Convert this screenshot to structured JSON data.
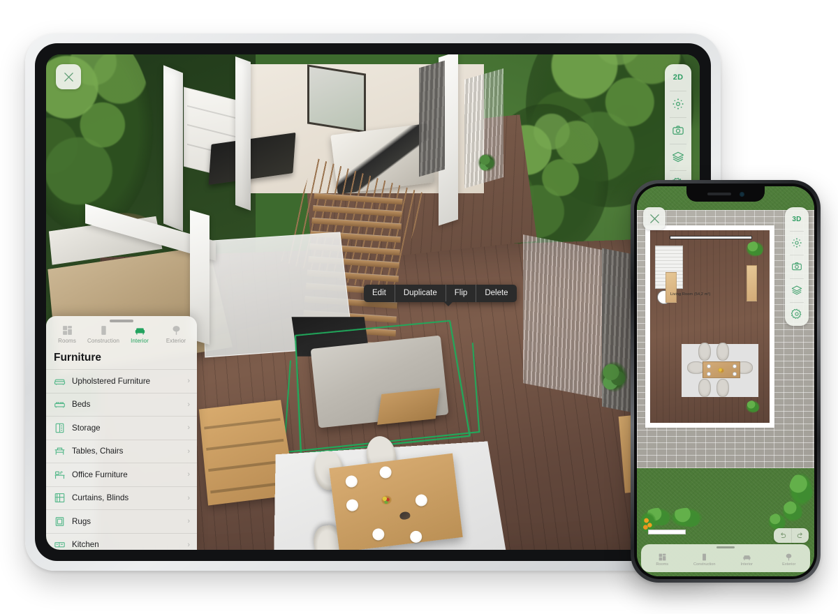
{
  "app": {
    "accent_green": "#23a35f",
    "selection_green": "#1faa5b",
    "panel_bg": "#f3f3f0",
    "context_menu_bg": "#2b2b2b"
  },
  "tablet": {
    "close_button": {
      "icon": "close-icon",
      "label": "Close"
    },
    "toolbar": [
      {
        "name": "view-mode-toggle",
        "icon": "2d-label",
        "label": "2D"
      },
      {
        "name": "orbit-tool",
        "icon": "orbit-icon",
        "label": ""
      },
      {
        "name": "camera-tool",
        "icon": "camera-icon",
        "label": ""
      },
      {
        "name": "layers-tool",
        "icon": "layers-icon",
        "label": ""
      },
      {
        "name": "settings-tool",
        "icon": "gear-icon",
        "label": ""
      }
    ],
    "context_menu": {
      "items": [
        {
          "label": "Edit"
        },
        {
          "label": "Duplicate"
        },
        {
          "label": "Flip"
        },
        {
          "label": "Delete"
        }
      ]
    },
    "panel": {
      "tabs": [
        {
          "label": "Rooms",
          "icon": "rooms-icon",
          "active": false
        },
        {
          "label": "Construction",
          "icon": "construction-icon",
          "active": false
        },
        {
          "label": "Interior",
          "icon": "interior-icon",
          "active": true
        },
        {
          "label": "Exterior",
          "icon": "exterior-icon",
          "active": false
        }
      ],
      "title": "Furniture",
      "items": [
        {
          "label": "Upholstered Furniture",
          "icon": "sofa-icon",
          "chevron": "›"
        },
        {
          "label": "Beds",
          "icon": "bed-icon",
          "chevron": "›"
        },
        {
          "label": "Storage",
          "icon": "storage-icon",
          "chevron": "›"
        },
        {
          "label": "Tables, Chairs",
          "icon": "table-chair-icon",
          "chevron": "›"
        },
        {
          "label": "Office Furniture",
          "icon": "office-desk-icon",
          "chevron": "›"
        },
        {
          "label": "Curtains, Blinds",
          "icon": "curtains-icon",
          "chevron": "›"
        },
        {
          "label": "Rugs",
          "icon": "rug-icon",
          "chevron": "›"
        },
        {
          "label": "Kitchen",
          "icon": "kitchen-icon",
          "chevron": "›"
        }
      ]
    }
  },
  "phone": {
    "close_button": {
      "icon": "close-icon",
      "label": "Close"
    },
    "toolbar": [
      {
        "name": "view-mode-toggle",
        "icon": "3d-label",
        "label": "3D"
      },
      {
        "name": "orbit-tool",
        "icon": "orbit-icon",
        "label": ""
      },
      {
        "name": "camera-tool",
        "icon": "camera-icon",
        "label": ""
      },
      {
        "name": "layers-tool",
        "icon": "layers-icon",
        "label": ""
      },
      {
        "name": "settings-tool",
        "icon": "gear-icon",
        "label": ""
      }
    ],
    "plan": {
      "room_label": "Living Room (54,2 m²)"
    },
    "history": [
      {
        "name": "undo-button",
        "icon": "undo-icon"
      },
      {
        "name": "redo-button",
        "icon": "redo-icon"
      }
    ],
    "tabs": [
      {
        "label": "Rooms",
        "icon": "rooms-icon",
        "active": false
      },
      {
        "label": "Construction",
        "icon": "construction-icon",
        "active": false
      },
      {
        "label": "Interior",
        "icon": "interior-icon",
        "active": false
      },
      {
        "label": "Exterior",
        "icon": "exterior-icon",
        "active": false
      }
    ]
  }
}
